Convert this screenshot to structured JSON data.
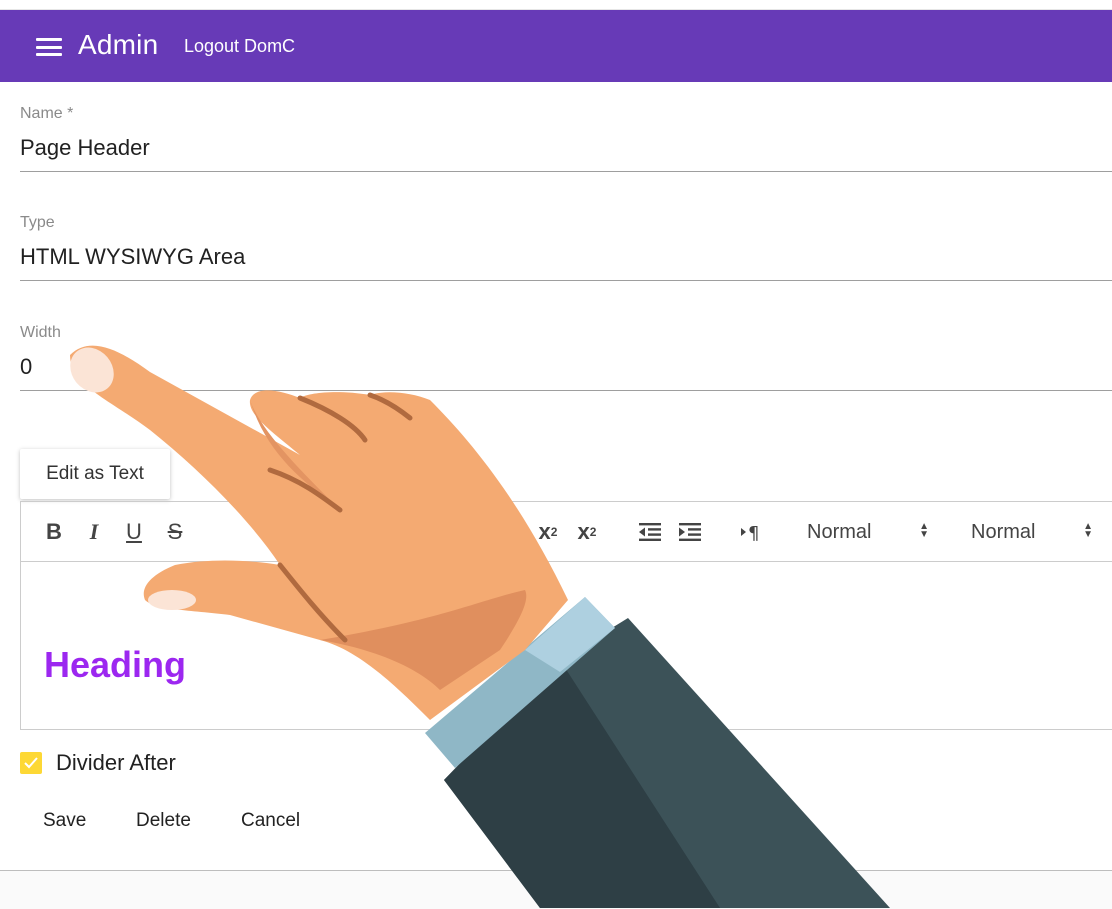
{
  "appbar": {
    "title": "Admin",
    "logout_label": "Logout DomC",
    "color": "#673ab7"
  },
  "form": {
    "name": {
      "label": "Name *",
      "value": "Page Header"
    },
    "type": {
      "label": "Type",
      "value": "HTML WYSIWYG Area"
    },
    "width": {
      "label": "Width",
      "value": "0"
    }
  },
  "editor": {
    "edit_as_text_label": "Edit as Text",
    "toolbar": {
      "bold": "B",
      "italic": "I",
      "underline": "U",
      "strike": "S",
      "subscript": "x",
      "subscript_mark": "2",
      "superscript": "x",
      "superscript_mark": "2",
      "outdent_icon": "outdent-icon",
      "indent_icon": "indent-icon",
      "direction_icon": "text-direction-icon",
      "pickers": [
        "Normal",
        "Normal"
      ]
    },
    "content": {
      "heading": "Heading",
      "heading_color": "#9c27f0"
    }
  },
  "divider_after": {
    "label": "Divider After",
    "checked": true,
    "color": "#fdd835"
  },
  "actions": {
    "save": "Save",
    "delete": "Delete",
    "cancel": "Cancel"
  }
}
